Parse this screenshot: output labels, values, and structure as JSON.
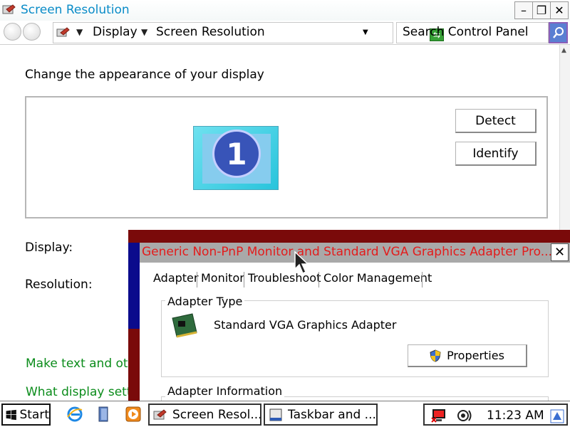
{
  "window": {
    "title": "Screen Resolution",
    "controls": {
      "minimize": "–",
      "maximize": "❐",
      "close": "✕"
    }
  },
  "address_bar": {
    "breadcrumb": [
      "Display",
      "Screen Resolution"
    ],
    "search_placeholder": "Search Control Panel"
  },
  "content": {
    "heading": "Change the appearance of your display",
    "monitor_number": "1",
    "detect_label": "Detect",
    "identify_label": "Identify",
    "display_label": "Display:",
    "resolution_label": "Resolution:",
    "link_text_size": "Make text and ot",
    "link_settings": "What display sett"
  },
  "dialog": {
    "title": "Generic Non-PnP Monitor and Standard VGA Graphics Adapter Pro...",
    "tabs": [
      "Adapter",
      "Monitor",
      "Troubleshoot",
      "Color Management"
    ],
    "active_tab": "Adapter",
    "adapter_type_label": "Adapter Type",
    "adapter_name": "Standard VGA Graphics Adapter",
    "properties_label": "Properties",
    "adapter_info_label": "Adapter Information",
    "title_color": "#e31c1c"
  },
  "taskbar": {
    "start_label": "Start",
    "tasks": [
      "Screen Resol...",
      "Taskbar and ..."
    ],
    "clock": "11:23 AM"
  },
  "icons": [
    "back-icon",
    "forward-icon",
    "control-panel-icon",
    "refresh-icon",
    "search-icon",
    "monitor-icon",
    "graphics-card-icon",
    "uac-shield-icon",
    "windows-logo-icon",
    "internet-explorer-icon",
    "show-desktop-icon",
    "media-player-icon",
    "network-icon",
    "volume-icon",
    "action-center-icon"
  ],
  "colors": {
    "title_blue": "#0a8cc8",
    "link_green": "#0b8c1b",
    "dialog_frame": "#7a0a0a",
    "dialog_side": "#0b0b8c"
  }
}
